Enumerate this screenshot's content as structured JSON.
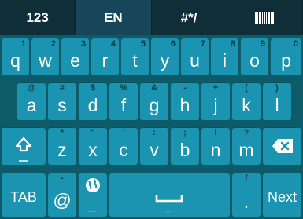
{
  "tabs": [
    {
      "label": "123"
    },
    {
      "label": "EN"
    },
    {
      "label": "#*/"
    },
    {
      "label": ""
    }
  ],
  "colors": {
    "key": "#1a94b1",
    "background": "#0d5a68",
    "tabbar": "#0d2b33",
    "active_tab": "#17465a"
  },
  "rows": {
    "r1": [
      {
        "main": "q",
        "sub": "1"
      },
      {
        "main": "w",
        "sub": "2"
      },
      {
        "main": "e",
        "sub": "3"
      },
      {
        "main": "r",
        "sub": "4"
      },
      {
        "main": "t",
        "sub": "5"
      },
      {
        "main": "y",
        "sub": "6"
      },
      {
        "main": "u",
        "sub": "7"
      },
      {
        "main": "i",
        "sub": "8"
      },
      {
        "main": "o",
        "sub": "9"
      },
      {
        "main": "p",
        "sub": "0"
      }
    ],
    "r2": [
      {
        "main": "a",
        "sub": "@"
      },
      {
        "main": "s",
        "sub": "#"
      },
      {
        "main": "d",
        "sub": "$"
      },
      {
        "main": "f",
        "sub": "%"
      },
      {
        "main": "g",
        "sub": "&"
      },
      {
        "main": "h",
        "sub": "-"
      },
      {
        "main": "j",
        "sub": "+"
      },
      {
        "main": "k",
        "sub": "("
      },
      {
        "main": "l",
        "sub": ")"
      }
    ],
    "r3": [
      {
        "main": "z",
        "sub": "*"
      },
      {
        "main": "x",
        "sub": "\""
      },
      {
        "main": "c",
        "sub": "'"
      },
      {
        "main": "v",
        "sub": ":"
      },
      {
        "main": "b",
        "sub": ";"
      },
      {
        "main": "n",
        "sub": "!"
      },
      {
        "main": "m",
        "sub": "?"
      }
    ]
  },
  "special": {
    "tab_label": "TAB",
    "at_label": "@",
    "at_sub": "-",
    "period_label": ".",
    "period_sub": "/",
    "next_label": "Next"
  },
  "icons": {
    "shift": "shift-icon",
    "backspace": "backspace-icon",
    "globe": "globe-icon",
    "space": "space-icon",
    "barcode": "barcode-icon"
  }
}
